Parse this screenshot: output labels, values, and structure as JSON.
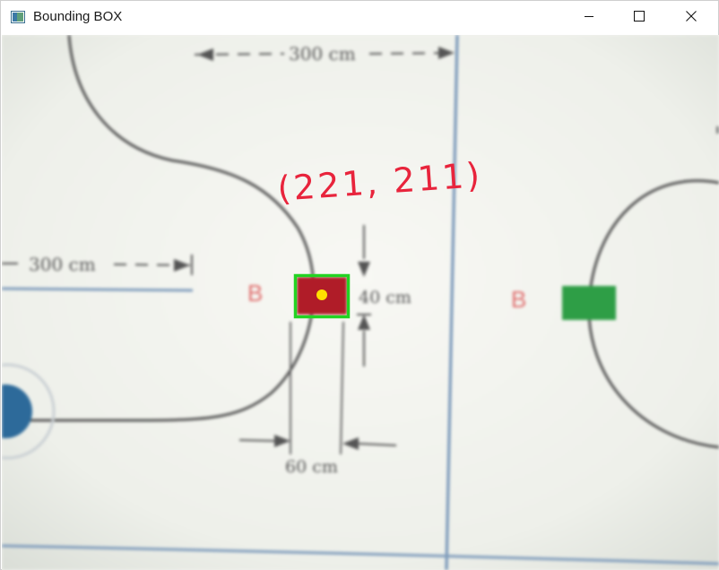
{
  "window": {
    "title": "Bounding BOX",
    "icon": "app-window-icon",
    "controls": [
      "minimize-icon",
      "maximize-icon",
      "close-icon"
    ]
  },
  "field": {
    "top_dimension": "300 cm",
    "left_dimension": "300 cm",
    "height_dimension": "40 cm",
    "width_dimension": "60 cm",
    "left_zone_label": "B",
    "right_zone_label": "B",
    "colors": {
      "red_block": "#b01c28",
      "green_block": "#2e9e46",
      "lines": "#4a4a4a",
      "blue_line": "#6e8fb4"
    }
  },
  "detection": {
    "coordinate_label": "(221, 211)",
    "box_color": "#22d322",
    "center_marker_color": "#ffe100",
    "label_color": "#e8243c"
  }
}
